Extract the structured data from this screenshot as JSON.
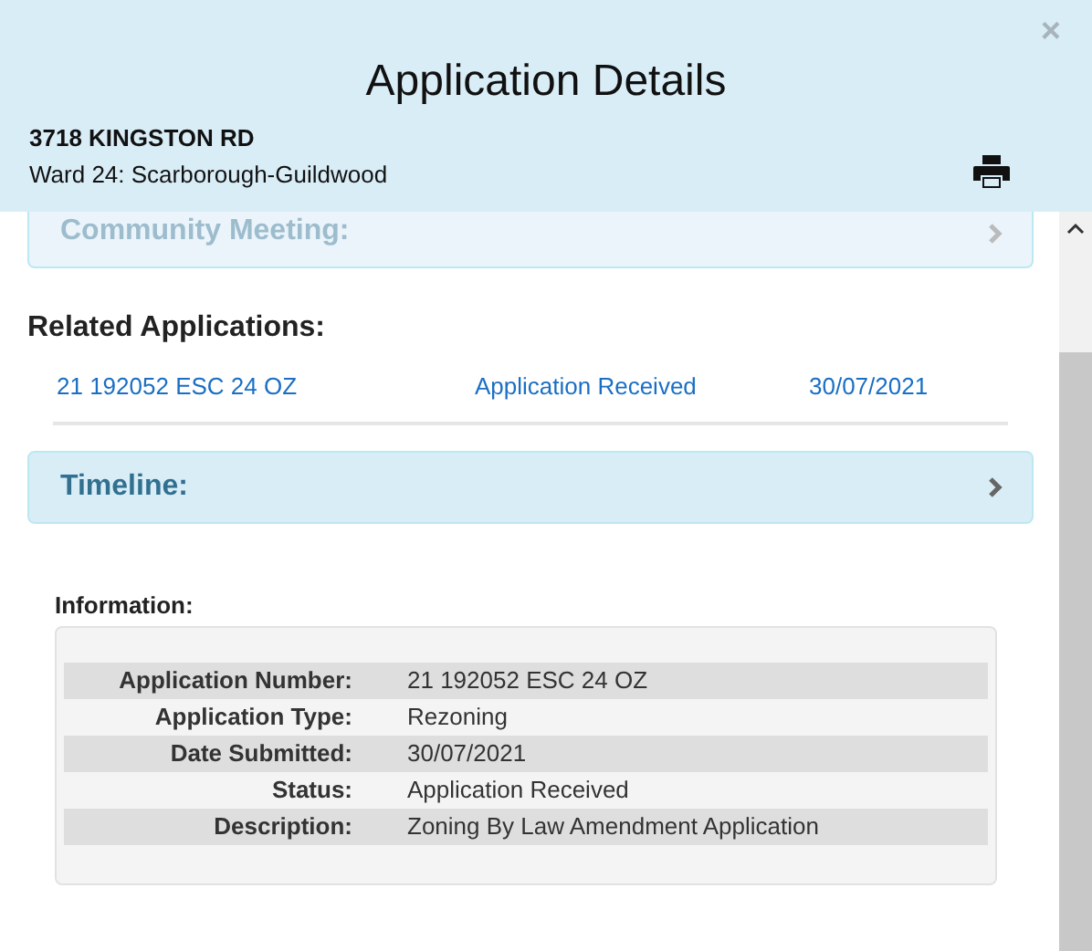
{
  "dialog": {
    "title": "Application Details",
    "close": "×",
    "address": "3718 KINGSTON RD",
    "ward": "Ward 24: Scarborough-Guildwood"
  },
  "panels_top": [
    {
      "label": "Community Meeting:",
      "faded": true
    }
  ],
  "related": {
    "heading": "Related Applications:",
    "rows": [
      [
        "21 192052 ESC 24 OZ",
        "Application Received",
        "30/07/2021"
      ]
    ]
  },
  "panels": [
    {
      "label": "Timeline:",
      "faded": false
    }
  ],
  "information": {
    "heading": "Information:",
    "rows": [
      {
        "label": "Application Number:",
        "value": "21 192052 ESC 24 OZ"
      },
      {
        "label": "Application Type:",
        "value": "Rezoning"
      },
      {
        "label": "Date Submitted:",
        "value": "30/07/2021"
      },
      {
        "label": "Status:",
        "value": "Application Received"
      },
      {
        "label": "Description:",
        "value": "Zoning By Law Amendment Application"
      }
    ]
  }
}
